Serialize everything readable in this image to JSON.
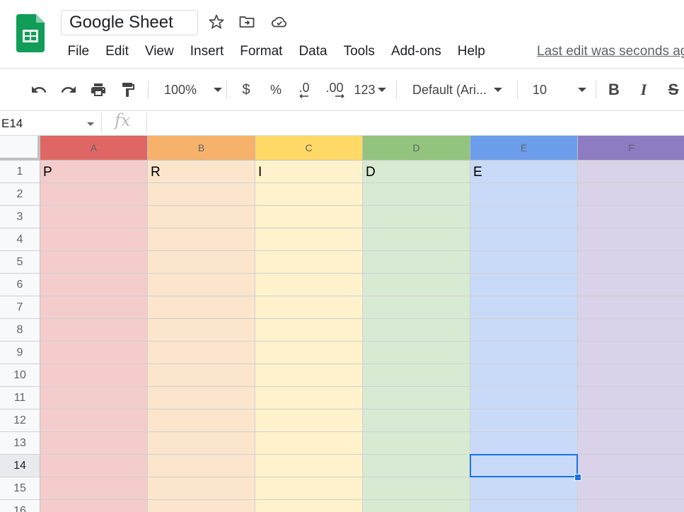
{
  "title_bar": {
    "doc_title": "Google Sheet",
    "icons": [
      "star-icon",
      "move-to-folder-icon",
      "cloud-saved-icon"
    ]
  },
  "menu": {
    "items": [
      "File",
      "Edit",
      "View",
      "Insert",
      "Format",
      "Data",
      "Tools",
      "Add-ons",
      "Help"
    ],
    "last_edit": "Last edit was seconds ago"
  },
  "toolbar": {
    "zoom": "100%",
    "currency": "$",
    "percent": "%",
    "decrease_decimal": ".0",
    "increase_decimal": ".00",
    "more_formats": "123",
    "font": "Default (Ari...",
    "font_size": "10",
    "bold": "B",
    "italic": "I",
    "strikethrough": "S"
  },
  "formula_bar": {
    "name_box": "E14",
    "fx": "fx",
    "value": ""
  },
  "sheet": {
    "columns": [
      "A",
      "B",
      "C",
      "D",
      "E",
      "F"
    ],
    "rows": [
      "1",
      "2",
      "3",
      "4",
      "5",
      "6",
      "7",
      "8",
      "9",
      "10",
      "11",
      "12",
      "13",
      "14",
      "15",
      "16"
    ],
    "row1_values": [
      "P",
      "R",
      "I",
      "D",
      "E",
      ""
    ],
    "selected_cell": "E14",
    "column_header_colors": [
      "#e06666",
      "#f6b26b",
      "#ffd966",
      "#93c47d",
      "#6d9eeb",
      "#8e7cc3"
    ],
    "column_fill_colors": [
      "#f4cccc",
      "#fce5cd",
      "#fff2cc",
      "#d9ead3",
      "#c9daf8",
      "#d9d2e9"
    ]
  },
  "colors": {
    "selection": "#1a73e8",
    "logo_green": "#0f9d58"
  }
}
